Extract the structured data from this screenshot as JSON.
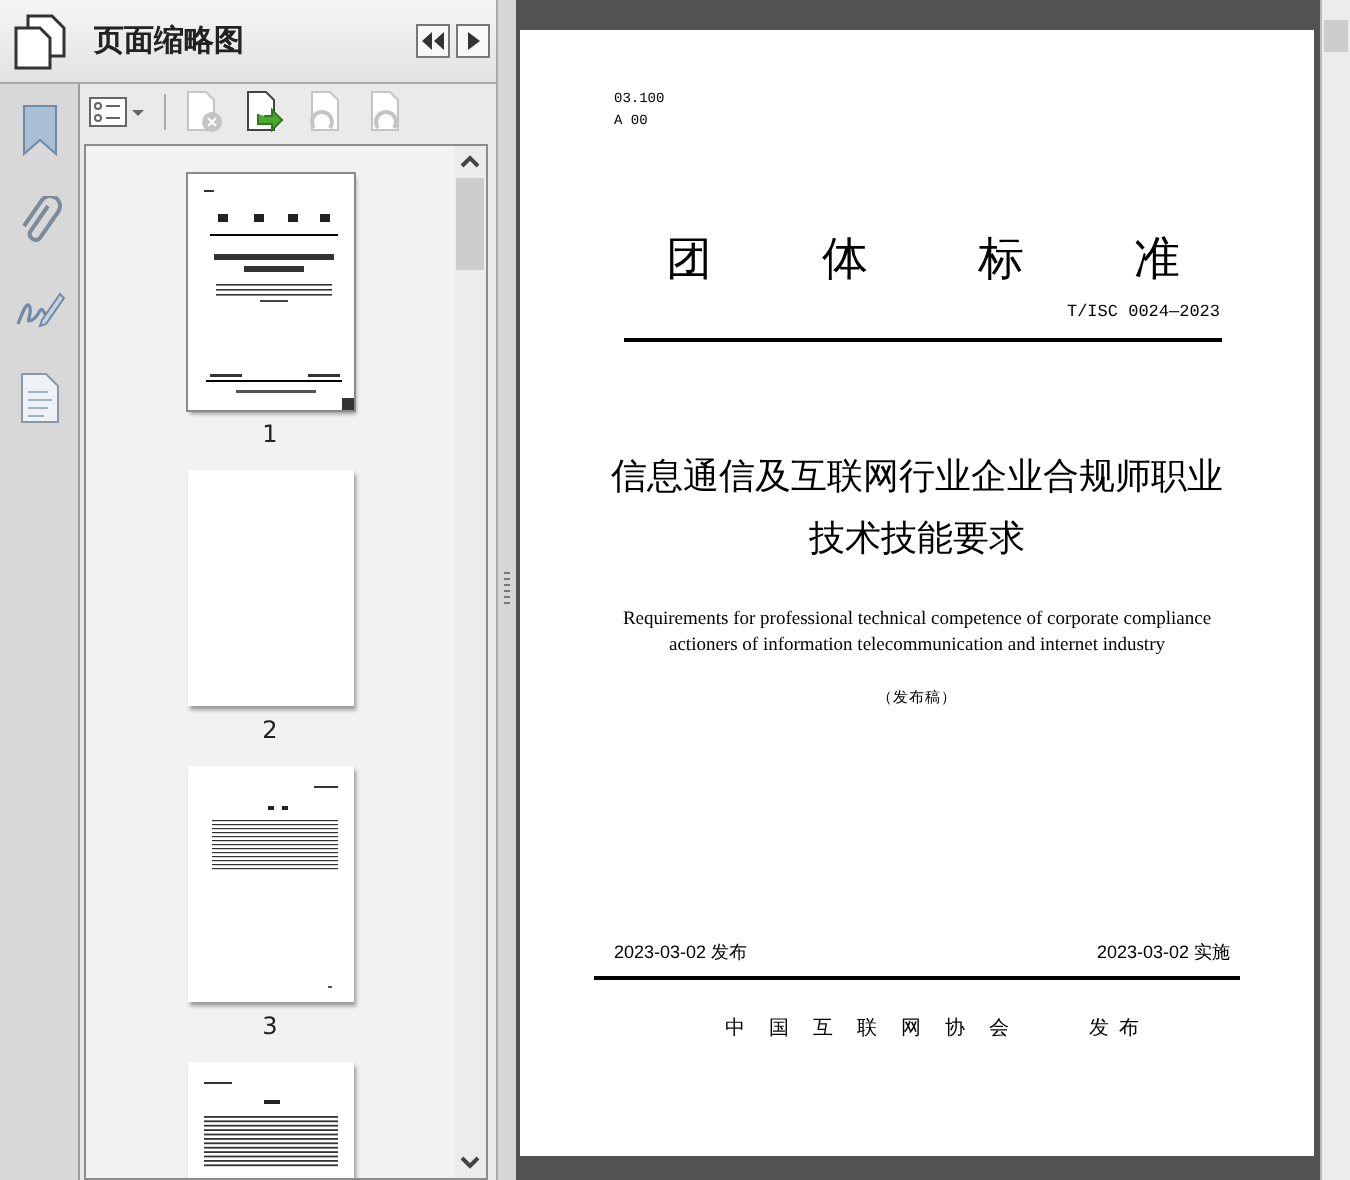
{
  "panel": {
    "title": "页面缩略图",
    "header_buttons": [
      {
        "kind": "collapse"
      },
      {
        "kind": "next"
      }
    ]
  },
  "rail": [
    {
      "kind": "bookmarks"
    },
    {
      "kind": "attachments"
    },
    {
      "kind": "signatures"
    },
    {
      "kind": "pages"
    }
  ],
  "toolbar": [
    {
      "kind": "options",
      "disabled": false
    },
    {
      "kind": "delete",
      "disabled": true
    },
    {
      "kind": "insert",
      "disabled": false
    },
    {
      "kind": "undo",
      "disabled": true
    },
    {
      "kind": "redo",
      "disabled": true
    }
  ],
  "thumbnails": [
    {
      "label": "1",
      "kind": "cover",
      "selected": true
    },
    {
      "label": "2",
      "kind": "blank",
      "selected": false
    },
    {
      "label": "3",
      "kind": "contents",
      "selected": false
    },
    {
      "kind": "text",
      "selected": false
    }
  ],
  "document": {
    "ics": "03.100",
    "ccs": "A 00",
    "heading": "团体标准",
    "number": "T/ISC 0024—2023",
    "title_lines": [
      "信息通信及互联网行业企业合规师职业",
      "技术技能要求"
    ],
    "english_lines": [
      "Requirements for professional technical competence of corporate compliance",
      "actioners of information telecommunication and internet industry"
    ],
    "stage": "（发布稿）",
    "publish_date": "2023-03-02 发布",
    "effective_date": "2023-03-02 实施",
    "issuer": "中国互联网协会",
    "issuer_action": "发布"
  }
}
